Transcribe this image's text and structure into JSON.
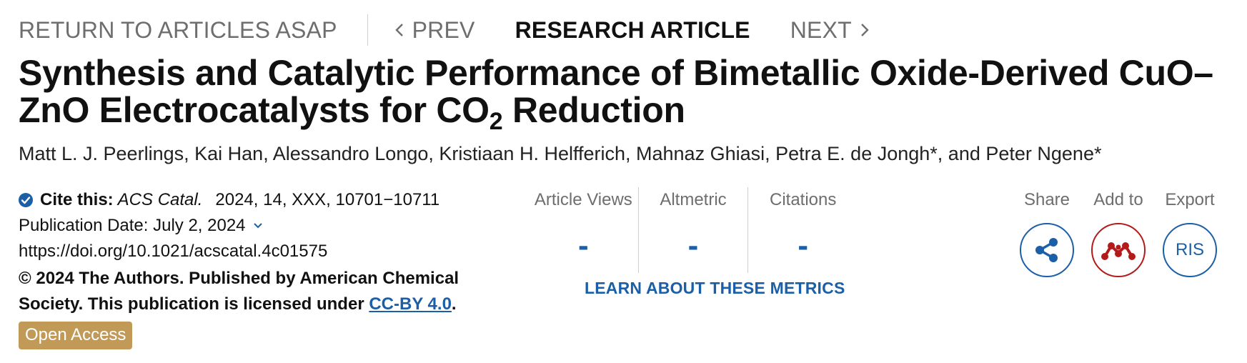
{
  "nav": {
    "return_label": "RETURN TO ARTICLES ASAP",
    "prev_label": "PREV",
    "current_label": "RESEARCH ARTICLE",
    "next_label": "NEXT"
  },
  "article": {
    "title_part1": "Synthesis and Catalytic Performance of Bimetallic Oxide-Derived CuO–ZnO Electrocatalysts for CO",
    "title_sub": "2",
    "title_part2": " Reduction",
    "authors": [
      "Matt L. J. Peerlings",
      "Kai Han",
      "Alessandro Longo",
      "Kristiaan H. Helfferich",
      "Mahnaz Ghiasi",
      "Petra E. de Jongh",
      "Peter Ngene"
    ],
    "corresponding_marker": "*",
    "author_separator": ", ",
    "author_last_joiner": ", and "
  },
  "citation": {
    "label": "Cite this:",
    "journal": "ACS Catal.",
    "details": "2024, 14, XXX, 10701−10711",
    "publication_date": "Publication Date: July 2, 2024",
    "doi": "https://doi.org/10.1021/acscatal.4c01575",
    "copyright": "© 2024 The Authors. Published by American Chemical Society. This publication is licensed under ",
    "license_label": "CC-BY 4.0",
    "license_period": ".",
    "open_access_label": "Open Access"
  },
  "metrics": {
    "items": [
      {
        "label": "Article Views",
        "value": "-"
      },
      {
        "label": "Altmetric",
        "value": "-"
      },
      {
        "label": "Citations",
        "value": "-"
      }
    ],
    "learn_label": "LEARN ABOUT THESE METRICS"
  },
  "actions": {
    "share_label": "Share",
    "add_label": "Add to",
    "export_label": "Export",
    "ris_label": "RIS"
  },
  "colors": {
    "link_blue": "#1b5fa7",
    "open_access_gold": "#c29a58",
    "mendeley_red": "#b31b1b",
    "muted_gray": "#6e6e6e"
  },
  "icons": {
    "share": "share-icon",
    "mendeley": "mendeley-icon",
    "verified": "check-circle-icon",
    "prev": "chevron-left-icon",
    "next": "chevron-right-icon",
    "expand": "chevron-down-icon"
  }
}
